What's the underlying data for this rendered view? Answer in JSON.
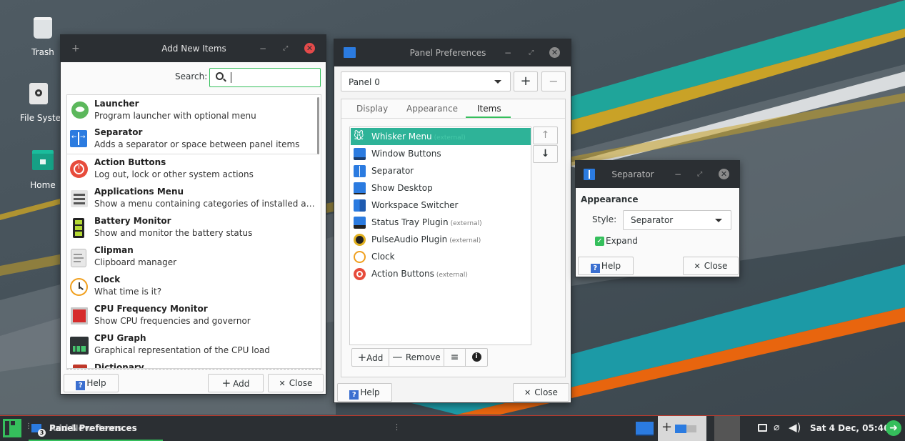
{
  "colors": {
    "accent": "#35bf5c",
    "teal": "#16a085",
    "selection": "#2eb398",
    "titlebar": "#2b2f33",
    "desktop": "#4a555c",
    "stripe_orange": "#e8650e",
    "stripe_teal": "#1c9aa6",
    "stripe_gold": "#c9a227"
  },
  "desktop": {
    "icons": [
      {
        "label": "Trash",
        "icon": "trash-icon"
      },
      {
        "label": "File System",
        "icon": "drive-icon"
      },
      {
        "label": "Home",
        "icon": "home-folder-icon"
      }
    ]
  },
  "add_items": {
    "title": "Add New Items",
    "search_label": "Search:",
    "search_value": "",
    "items": [
      {
        "title": "Launcher",
        "desc": "Program launcher with optional menu",
        "icon": "rocket-icon"
      },
      {
        "title": "Separator",
        "desc": "Adds a separator or space between panel items",
        "icon": "separator-icon"
      },
      {
        "title": "Action Buttons",
        "desc": "Log out, lock or other system actions",
        "icon": "power-icon"
      },
      {
        "title": "Applications Menu",
        "desc": "Show a menu containing categories of installed applic...",
        "icon": "menu-list-icon"
      },
      {
        "title": "Battery Monitor",
        "desc": "Show and monitor the battery status",
        "icon": "battery-icon"
      },
      {
        "title": "Clipman",
        "desc": "Clipboard manager",
        "icon": "clipboard-icon"
      },
      {
        "title": "Clock",
        "desc": "What time is it?",
        "icon": "clock-icon"
      },
      {
        "title": "CPU Frequency Monitor",
        "desc": "Show CPU frequencies and governor",
        "icon": "cpu-icon"
      },
      {
        "title": "CPU Graph",
        "desc": "Graphical representation of the CPU load",
        "icon": "graph-icon"
      },
      {
        "title": "Dictionary",
        "desc": "",
        "icon": "dictionary-icon"
      }
    ],
    "help": "Help",
    "add": "Add",
    "close": "Close"
  },
  "panel_prefs": {
    "title": "Panel Preferences",
    "panel_select": "Panel 0",
    "tabs": [
      "Display",
      "Appearance",
      "Items"
    ],
    "active_tab": "Items",
    "items": [
      {
        "label": "Whisker Menu",
        "ext": "(external)",
        "icon": "whisker-icon"
      },
      {
        "label": "Window Buttons",
        "ext": "",
        "icon": "window-buttons-icon"
      },
      {
        "label": "Separator",
        "ext": "",
        "icon": "separator-icon"
      },
      {
        "label": "Show Desktop",
        "ext": "",
        "icon": "show-desktop-icon"
      },
      {
        "label": "Workspace Switcher",
        "ext": "",
        "icon": "workspace-icon"
      },
      {
        "label": "Status Tray Plugin",
        "ext": "(external)",
        "icon": "status-tray-icon"
      },
      {
        "label": "PulseAudio Plugin",
        "ext": "(external)",
        "icon": "speaker-icon"
      },
      {
        "label": "Clock",
        "ext": "",
        "icon": "clock-icon"
      },
      {
        "label": "Action Buttons",
        "ext": "(external)",
        "icon": "power-icon"
      }
    ],
    "add": "Add",
    "remove": "Remove",
    "help": "Help",
    "close": "Close"
  },
  "separator_dialog": {
    "title": "Separator",
    "section": "Appearance",
    "style_label": "Style:",
    "style_value": "Separator",
    "expand_label": "Expand",
    "expand_checked": true,
    "help": "Help",
    "close": "Close"
  },
  "taskbar": {
    "task_label": "Panel Preferences",
    "task_label_overlap": "Add New Items",
    "task_count": "3",
    "datetime": "Sat 4 Dec, 05:46"
  }
}
